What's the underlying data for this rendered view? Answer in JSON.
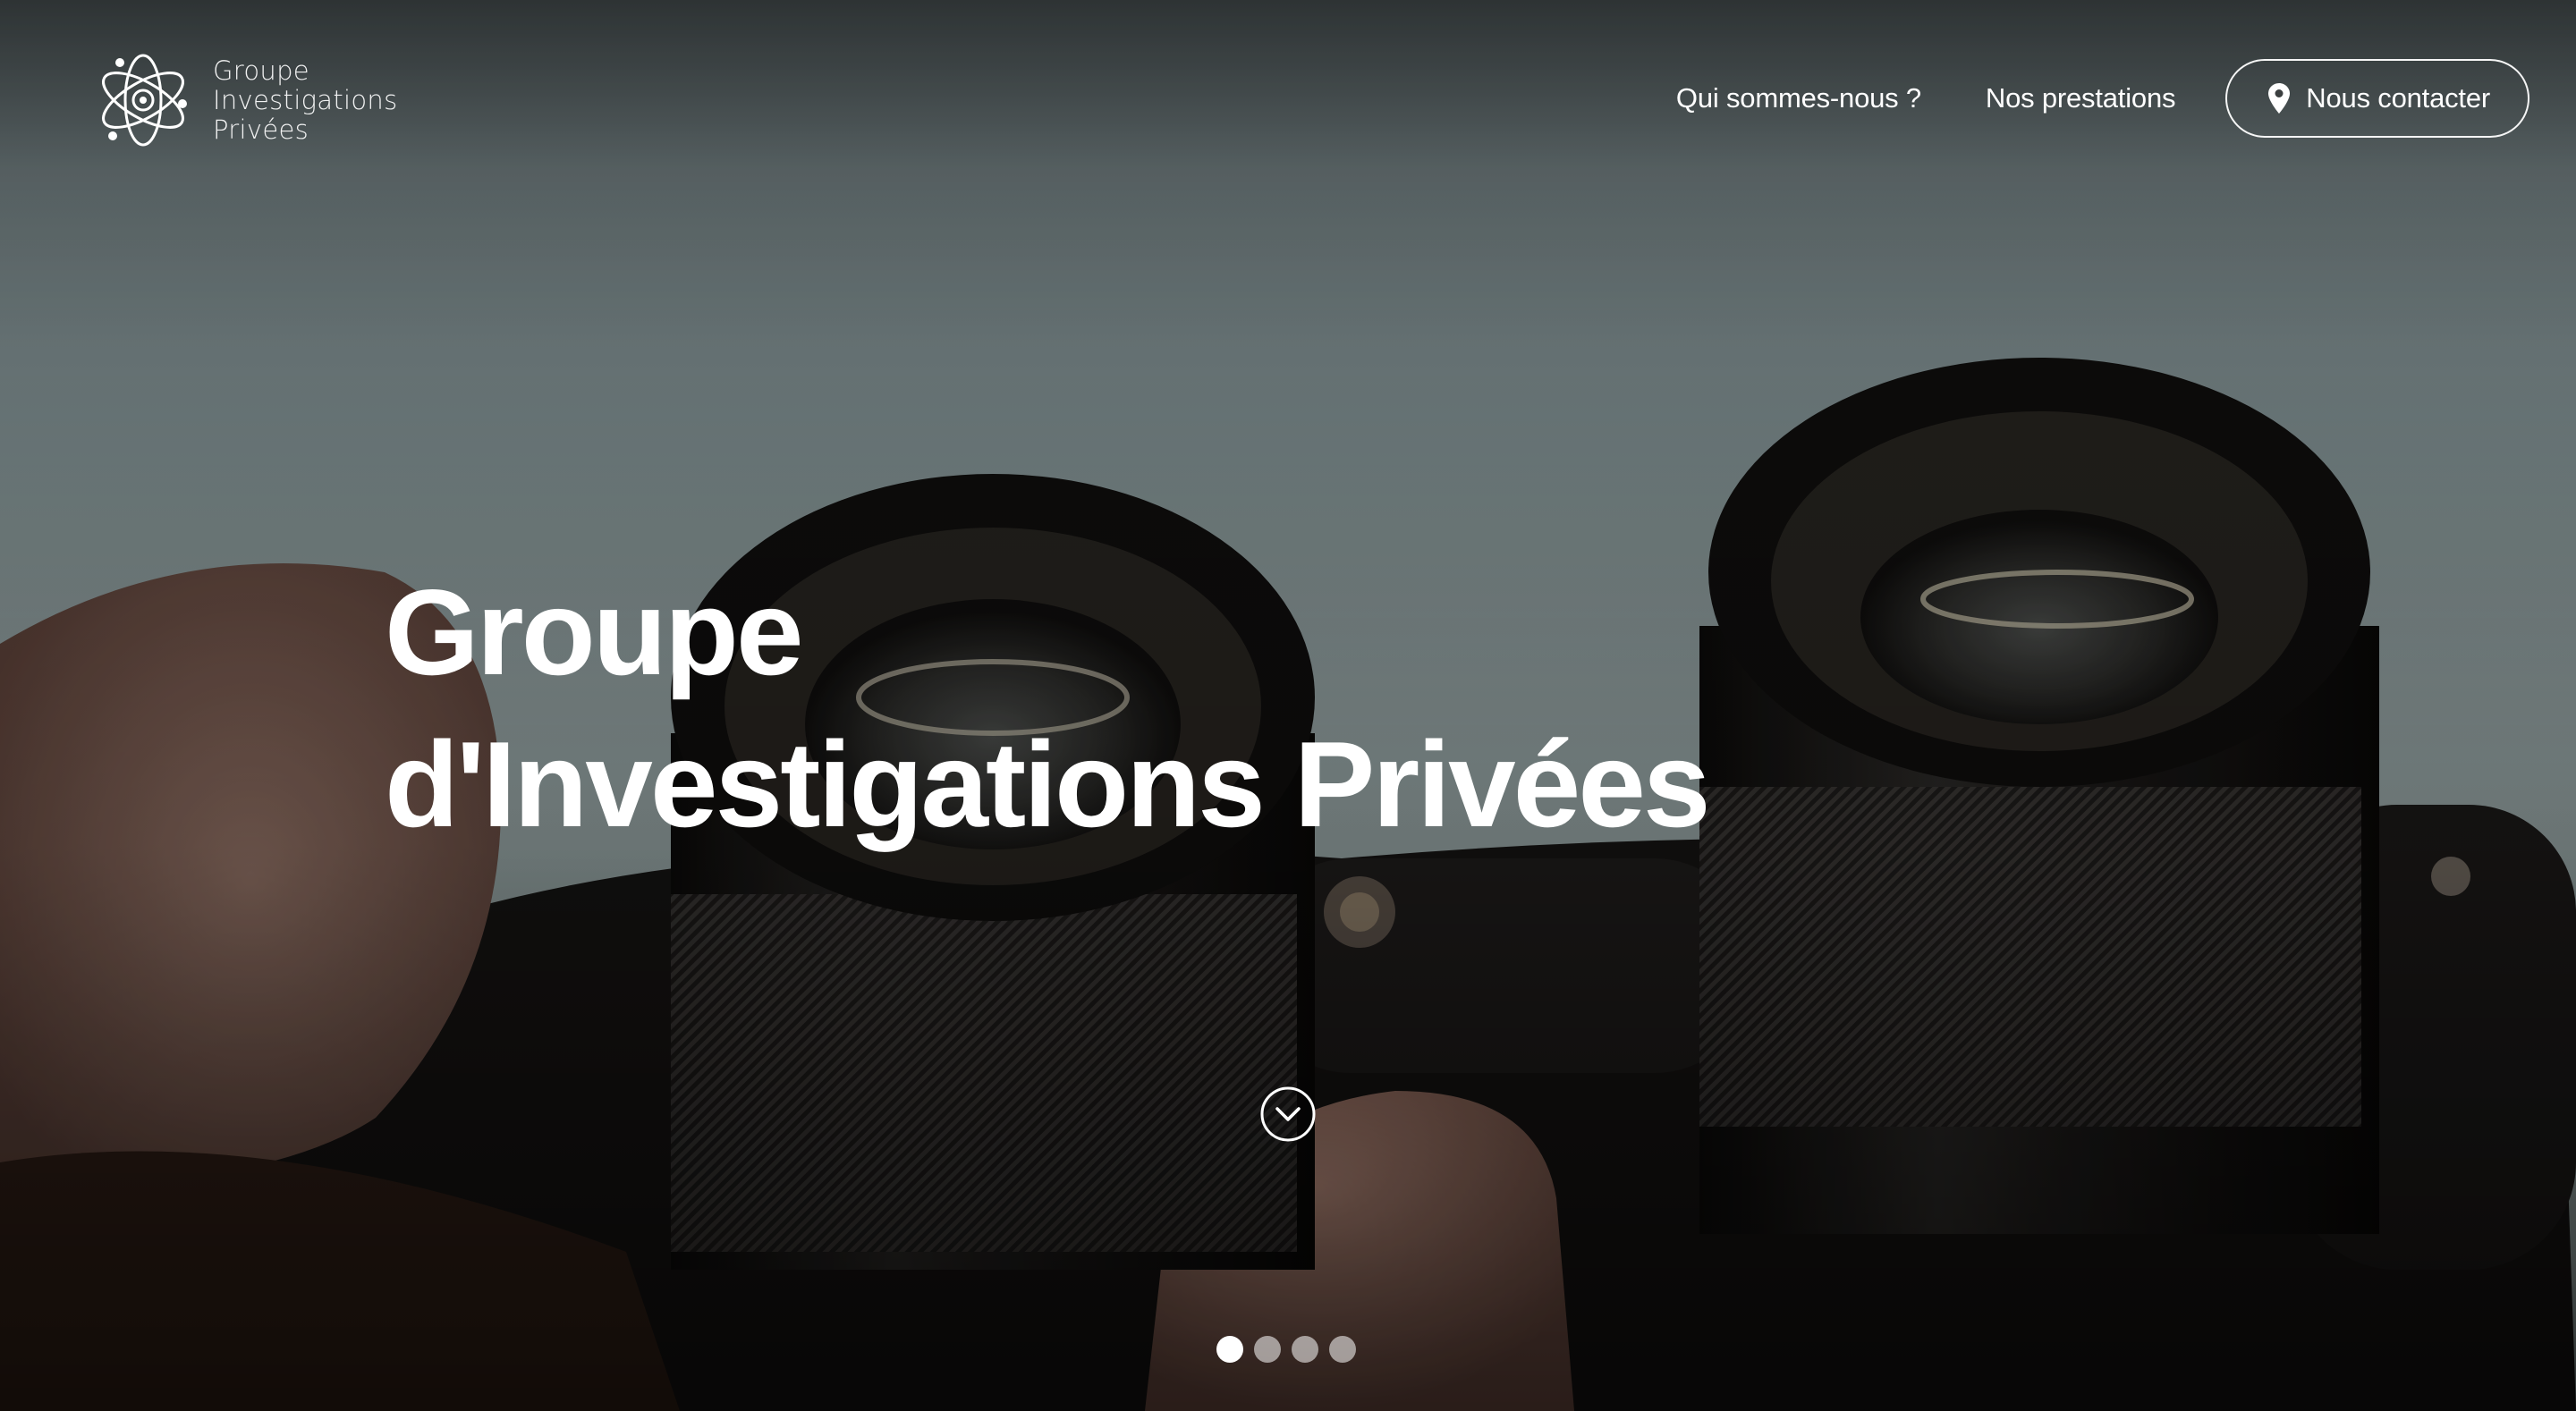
{
  "brand": {
    "line1": "Groupe",
    "line2": "Investigations",
    "line3": "Privées"
  },
  "nav": {
    "about": "Qui sommes-nous ?",
    "services": "Nos prestations",
    "contact": "Nous contacter"
  },
  "hero": {
    "title_line1": "Groupe",
    "title_line2": "d'Investigations Privées"
  },
  "carousel": {
    "slide_count": 4,
    "active_index": 0
  },
  "icons": {
    "logo": "atom-logo-icon",
    "contact": "map-pin-icon",
    "scroll": "chevron-down-circle-icon"
  },
  "colors": {
    "text": "#ffffff",
    "overlay": "#000000"
  }
}
